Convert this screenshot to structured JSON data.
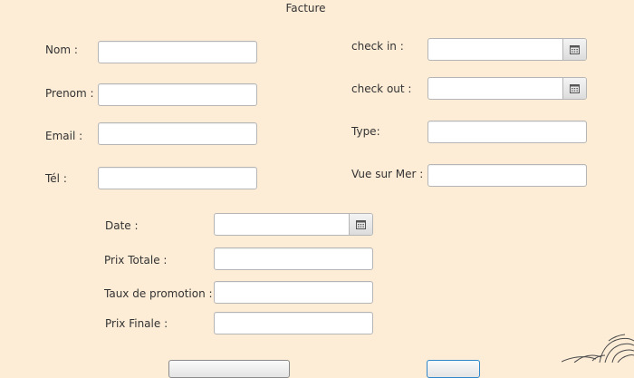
{
  "window": {
    "title": "Facture"
  },
  "client": {
    "nom_label": "Nom :",
    "prenom_label": "Prenom :",
    "email_label": "Email :",
    "tel_label": "Tél :",
    "nom_value": "",
    "prenom_value": "",
    "email_value": "",
    "tel_value": ""
  },
  "reservation": {
    "checkin_label": "check in :",
    "checkout_label": "check out :",
    "type_label": "Type:",
    "vue_label": "Vue sur Mer :",
    "checkin_value": "",
    "checkout_value": "",
    "type_value": "",
    "vue_value": ""
  },
  "facture": {
    "date_label": "Date :",
    "prix_totale_label": "Prix Totale :",
    "taux_label": "Taux de promotion :",
    "prix_finale_label": "Prix Finale :",
    "date_value": "",
    "prix_totale_value": "",
    "taux_value": "",
    "prix_finale_value": ""
  },
  "icons": {
    "calendar": "calendar-icon"
  }
}
